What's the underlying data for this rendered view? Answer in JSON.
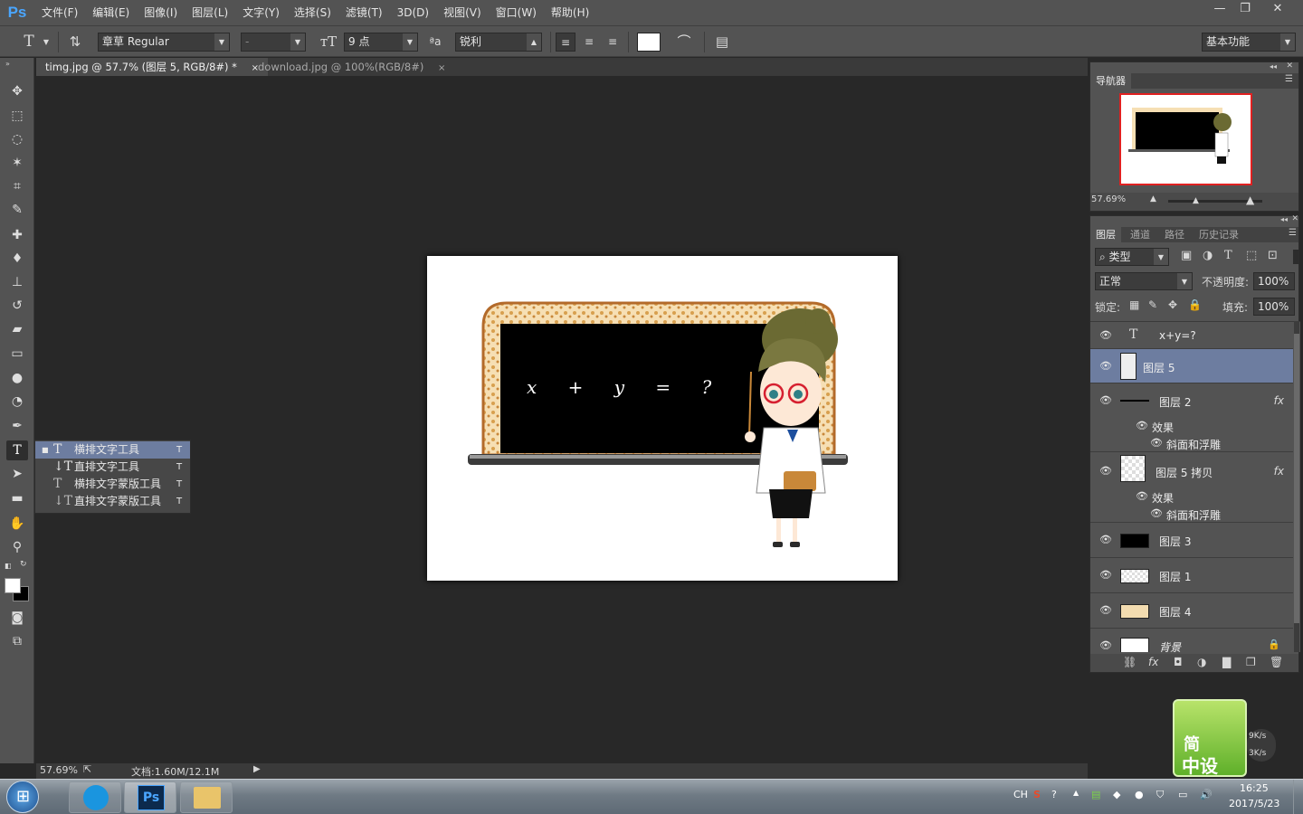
{
  "app": {
    "logo": "Ps"
  },
  "menu": [
    "文件(F)",
    "编辑(E)",
    "图像(I)",
    "图层(L)",
    "文字(Y)",
    "选择(S)",
    "滤镜(T)",
    "3D(D)",
    "视图(V)",
    "窗口(W)",
    "帮助(H)"
  ],
  "window_controls": {
    "minimize": "—",
    "restore": "❐",
    "close": "✕"
  },
  "options": {
    "font_family": "章草 Regular",
    "font_style": "-",
    "font_size": "9 点",
    "aa_label": "ªa",
    "antialias": "锐利",
    "workspace": "基本功能"
  },
  "tabs": [
    {
      "label": "timg.jpg @ 57.7% (图层 5, RGB/8#) *",
      "close": "×"
    },
    {
      "label": "download.jpg @ 100%(RGB/8#)",
      "close": "×"
    }
  ],
  "flyout": [
    {
      "label": "横排文字工具",
      "key": "T"
    },
    {
      "label": "直排文字工具",
      "key": "T"
    },
    {
      "label": "横排文字蒙版工具",
      "key": "T"
    },
    {
      "label": "直排文字蒙版工具",
      "key": "T"
    }
  ],
  "status": {
    "zoom": "57.69%",
    "doc": "文档:1.60M/12.1M"
  },
  "navigator": {
    "title": "导航器",
    "zoom": "57.69%"
  },
  "layers_panel": {
    "tabs": [
      "图层",
      "通道",
      "路径",
      "历史记录"
    ],
    "filter": "类型",
    "blend_mode": "正常",
    "opacity_label": "不透明度:",
    "opacity": "100%",
    "lock_label": "锁定:",
    "fill_label": "填充:",
    "fill": "100%",
    "layers": [
      {
        "name": "x+y=?",
        "type": "text"
      },
      {
        "name": "图层 5",
        "selected": true
      },
      {
        "name": "图层 2",
        "fx": "fx",
        "effects_label": "效果",
        "effect": "斜面和浮雕"
      },
      {
        "name": "图层 5 拷贝",
        "fx": "fx",
        "effects_label": "效果",
        "effect": "斜面和浮雕"
      },
      {
        "name": "图层 3"
      },
      {
        "name": "图层 1"
      },
      {
        "name": "图层 4"
      },
      {
        "name": "背景",
        "locked": true
      }
    ]
  },
  "artwork": {
    "equation": "x + y = ?"
  },
  "widget": {
    "line1": "简",
    "line2": "中设",
    "speed_up": "9K/s",
    "speed_down": "3K/s"
  },
  "taskbar": {
    "lang": "CH",
    "time": "16:25",
    "date": "2017/5/23"
  },
  "colors": {
    "accent": "#4aa6ff",
    "selection": "#6d7da0",
    "panel": "#535353",
    "canvas_bg": "#282828"
  }
}
